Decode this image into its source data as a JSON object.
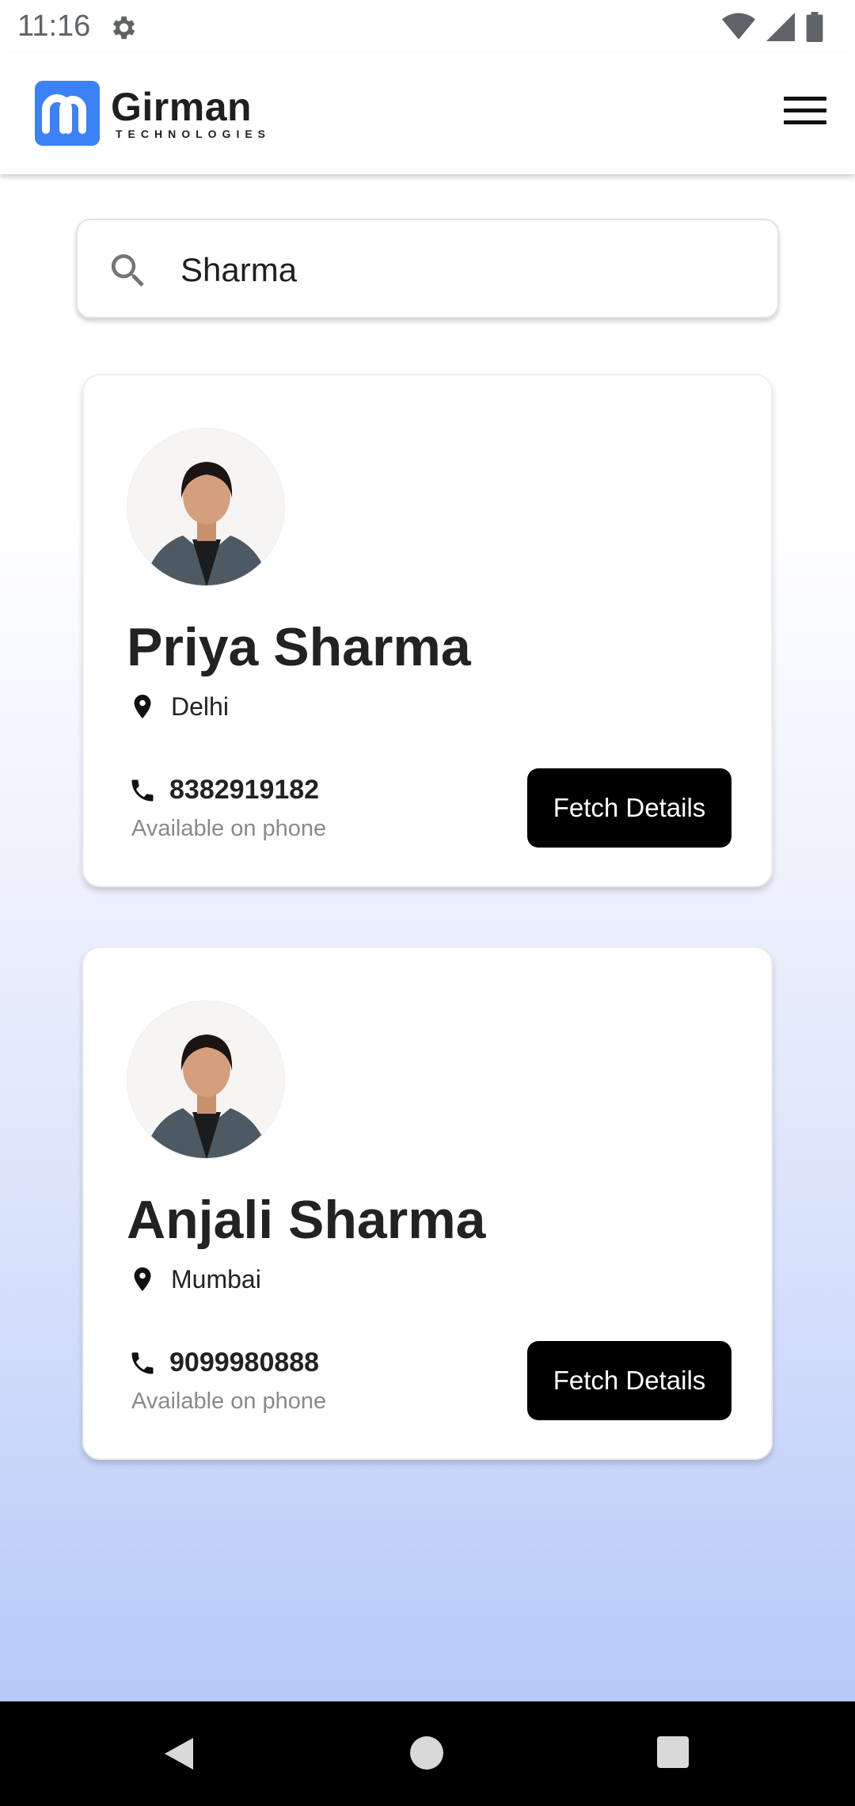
{
  "status_bar": {
    "time": "11:16",
    "icons": [
      "gear-icon",
      "wifi-icon",
      "signal-icon",
      "battery-icon"
    ]
  },
  "header": {
    "logo_name": "Girman",
    "logo_tagline": "TECHNOLOGIES",
    "menu_icon": "hamburger-menu-icon",
    "brand_color": "#3b82f6"
  },
  "search": {
    "icon": "search-icon",
    "value": "Sharma",
    "placeholder": ""
  },
  "results": [
    {
      "name": "Priya Sharma",
      "location": "Delhi",
      "phone": "8382919182",
      "availability": "Available on phone",
      "button_label": "Fetch Details"
    },
    {
      "name": "Anjali Sharma",
      "location": "Mumbai",
      "phone": "9099980888",
      "availability": "Available on phone",
      "button_label": "Fetch Details"
    }
  ],
  "nav_bar": {
    "buttons": [
      "back-icon",
      "home-icon",
      "recents-icon"
    ]
  }
}
